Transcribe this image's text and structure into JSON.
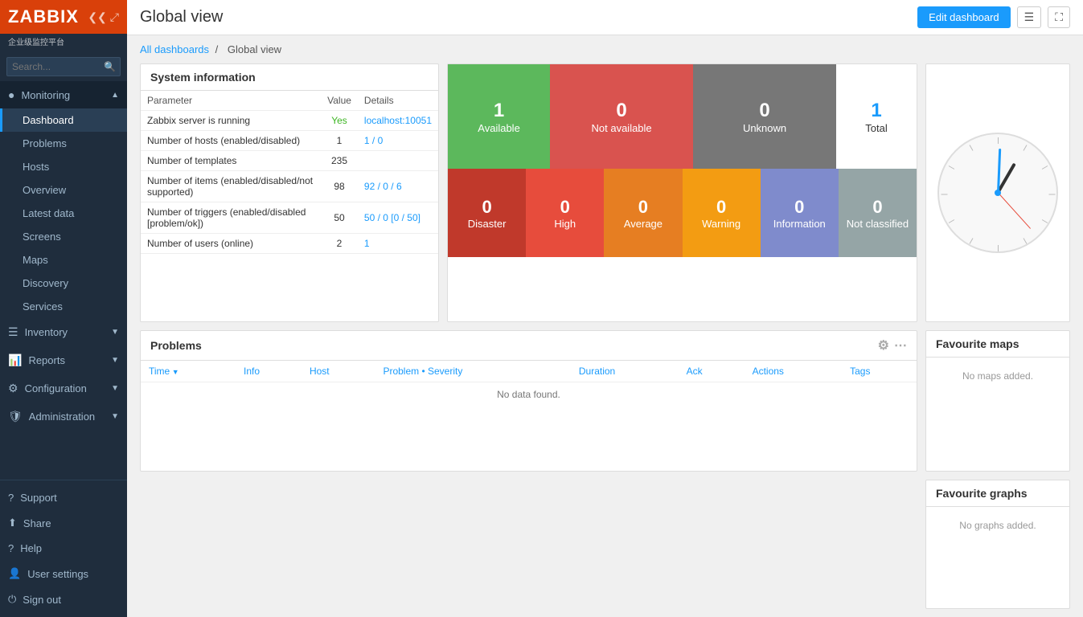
{
  "app": {
    "name": "ZABBIX",
    "subtitle": "企业级监控平台",
    "page_title": "Global view"
  },
  "breadcrumb": {
    "parent": "All dashboards",
    "current": "Global view"
  },
  "topbar": {
    "edit_dashboard": "Edit dashboard"
  },
  "sidebar": {
    "search_placeholder": "Search...",
    "nav": {
      "monitoring_label": "Monitoring",
      "sub_items": [
        {
          "label": "Dashboard",
          "active": true
        },
        {
          "label": "Problems"
        },
        {
          "label": "Hosts"
        },
        {
          "label": "Overview"
        },
        {
          "label": "Latest data"
        },
        {
          "label": "Screens"
        },
        {
          "label": "Maps"
        },
        {
          "label": "Discovery"
        },
        {
          "label": "Services"
        }
      ],
      "inventory_label": "Inventory",
      "reports_label": "Reports",
      "configuration_label": "Configuration",
      "administration_label": "Administration"
    },
    "bottom": [
      {
        "label": "Support",
        "icon": "?"
      },
      {
        "label": "Share",
        "icon": "⬆"
      },
      {
        "label": "Help",
        "icon": "?"
      },
      {
        "label": "User settings",
        "icon": "👤"
      },
      {
        "label": "Sign out",
        "icon": "⏻"
      }
    ]
  },
  "system_info": {
    "title": "System information",
    "columns": [
      "Parameter",
      "Value",
      "Details"
    ],
    "rows": [
      {
        "parameter": "Zabbix server is running",
        "value": "Yes",
        "value_color": "green",
        "details": "localhost:10051"
      },
      {
        "parameter": "Number of hosts (enabled/disabled)",
        "value": "1",
        "details": "1 / 0"
      },
      {
        "parameter": "Number of templates",
        "value": "235",
        "details": ""
      },
      {
        "parameter": "Number of items (enabled/disabled/not supported)",
        "value": "98",
        "details": "92 / 0 / 6"
      },
      {
        "parameter": "Number of triggers (enabled/disabled [problem/ok])",
        "value": "50",
        "details": "50 / 0 [0 / 50]"
      },
      {
        "parameter": "Number of users (online)",
        "value": "2",
        "details": "1"
      }
    ]
  },
  "host_availability": {
    "available": {
      "count": "1",
      "label": "Available"
    },
    "not_available": {
      "count": "0",
      "label": "Not available"
    },
    "unknown": {
      "count": "0",
      "label": "Unknown"
    },
    "total": {
      "count": "1",
      "label": "Total"
    },
    "severities": [
      {
        "count": "0",
        "label": "Disaster",
        "class": "disaster"
      },
      {
        "count": "0",
        "label": "High",
        "class": "high"
      },
      {
        "count": "0",
        "label": "Average",
        "class": "average"
      },
      {
        "count": "0",
        "label": "Warning",
        "class": "warning"
      },
      {
        "count": "0",
        "label": "Information",
        "class": "information"
      },
      {
        "count": "0",
        "label": "Not classified",
        "class": "not-classified"
      }
    ]
  },
  "problems": {
    "title": "Problems",
    "columns": [
      "Time",
      "Info",
      "Host",
      "Problem • Severity",
      "Duration",
      "Ack",
      "Actions",
      "Tags"
    ],
    "no_data": "No data found."
  },
  "favourite_maps": {
    "title": "Favourite maps",
    "no_items": "No maps added."
  },
  "favourite_graphs": {
    "title": "Favourite graphs",
    "no_items": "No graphs added."
  }
}
